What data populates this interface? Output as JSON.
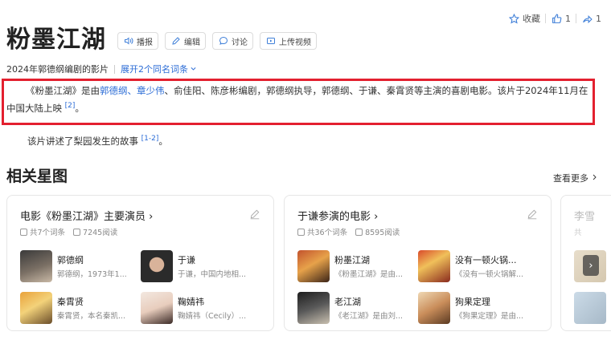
{
  "top_actions": {
    "collect_label": "收藏",
    "like_count": "1",
    "share_count": "1"
  },
  "title": "粉墨江湖",
  "toolbar": {
    "play": "播报",
    "edit": "编辑",
    "discuss": "讨论",
    "upload": "上传视频"
  },
  "subtitle": {
    "desc": "2024年郭德纲编剧的影片",
    "expand": "展开2个同名词条"
  },
  "summary": {
    "p1": "《粉墨江湖》是由",
    "link1": "郭德纲",
    "sep1": "、",
    "link2": "章少伟",
    "p2": "、俞佳阳、陈彦彬编剧，郭德纲执导，郭德纲、于谦、秦霄贤等主演的喜剧电影。该片于2024年11月在中国大陆上映",
    "ref": "[2]",
    "end": "。"
  },
  "story": {
    "text": "该片讲述了梨园发生的故事",
    "ref": "[1-2]",
    "end": "。"
  },
  "section": {
    "title": "相关星图",
    "see_more": "查看更多"
  },
  "cards": [
    {
      "title": "电影《粉墨江湖》主要演员",
      "count": "共7个词条",
      "reads": "7245阅读",
      "entries": [
        {
          "name": "郭德纲",
          "desc": "郭德纲，1973年1..."
        },
        {
          "name": "于谦",
          "desc": "于谦，中国内地相..."
        },
        {
          "name": "秦霄贤",
          "desc": "秦霄贤，本名秦凯..."
        },
        {
          "name": "鞠婧祎",
          "desc": "鞠婧祎（Cecily）..."
        }
      ]
    },
    {
      "title": "于谦参演的电影",
      "count": "共36个词条",
      "reads": "8595阅读",
      "entries": [
        {
          "name": "粉墨江湖",
          "desc": "《粉墨江湖》是由..."
        },
        {
          "name": "没有一顿火锅...",
          "desc": "《没有一顿火锅解..."
        },
        {
          "name": "老江湖",
          "desc": "《老江湖》是由刘..."
        },
        {
          "name": "狗果定理",
          "desc": "《狗果定理》是由..."
        }
      ]
    }
  ],
  "card3": {
    "title": "李雪",
    "meta": "共"
  },
  "colors": {
    "link": "#2b6cd6",
    "highlight_border": "#e3202f"
  }
}
